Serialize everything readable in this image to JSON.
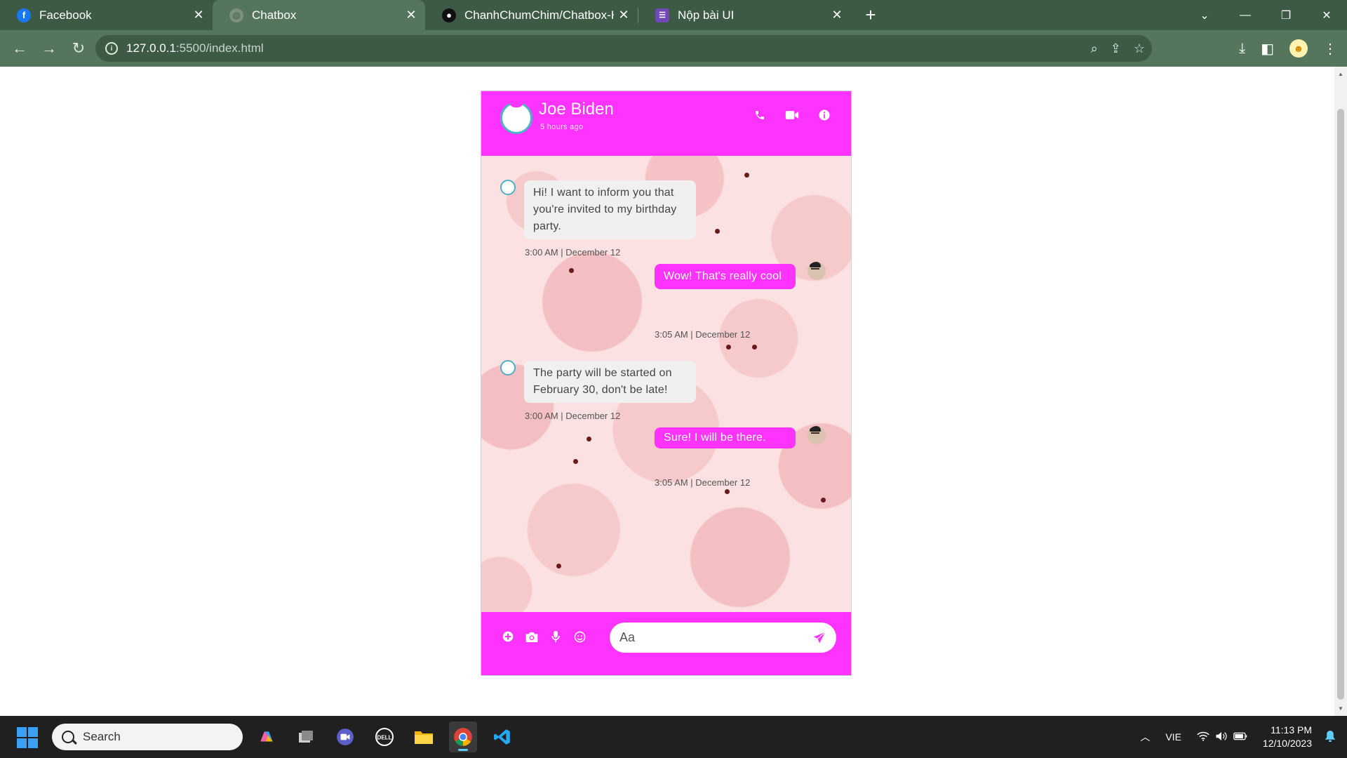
{
  "browser": {
    "tabs": [
      {
        "title": "Facebook",
        "icon": "facebook-icon",
        "active": false
      },
      {
        "title": "Chatbox",
        "icon": "globe-icon",
        "active": true
      },
      {
        "title": "ChanhChumChim/Chatbox-Hom",
        "icon": "github-icon",
        "active": false
      },
      {
        "title": "Nộp bài UI",
        "icon": "form-icon",
        "active": false
      }
    ],
    "url_host": "127.0.0.1",
    "url_path": ":5500/index.html"
  },
  "chat": {
    "contact_name": "Joe Biden",
    "status": "5 hours ago",
    "input_placeholder": "Aa",
    "accent": "#ff33ff",
    "messages": [
      {
        "side": "in",
        "text": "Hi! I want to inform you that you're invited to my birthday party.",
        "time": "3:00 AM | December 12"
      },
      {
        "side": "out",
        "text": "Wow! That's really cool",
        "time": "3:05 AM | December 12"
      },
      {
        "side": "in",
        "text": "The party will be started on February 30, don't be late!",
        "time": "3:00 AM | December 12"
      },
      {
        "side": "out",
        "text": "Sure! I will be there.",
        "time": "3:05 AM | December 12"
      }
    ]
  },
  "taskbar": {
    "search_label": "Search",
    "language": "VIE",
    "time": "11:13 PM",
    "date": "12/10/2023"
  }
}
